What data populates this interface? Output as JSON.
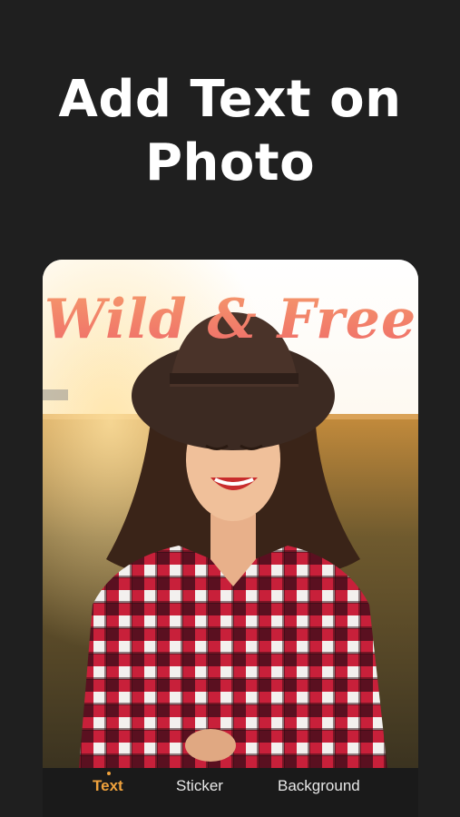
{
  "headline": {
    "line1": "Add Text on",
    "line2": "Photo"
  },
  "photo": {
    "overlay_text": "Wild & Free",
    "description_icon": "portrait-photo"
  },
  "tabs": [
    {
      "label": "Text",
      "active": true
    },
    {
      "label": "Sticker",
      "active": false
    },
    {
      "label": "Background",
      "active": false
    }
  ],
  "colors": {
    "background": "#1f1f1f",
    "accent": "#f0a23c",
    "overlay_text": "#f27a5e"
  }
}
